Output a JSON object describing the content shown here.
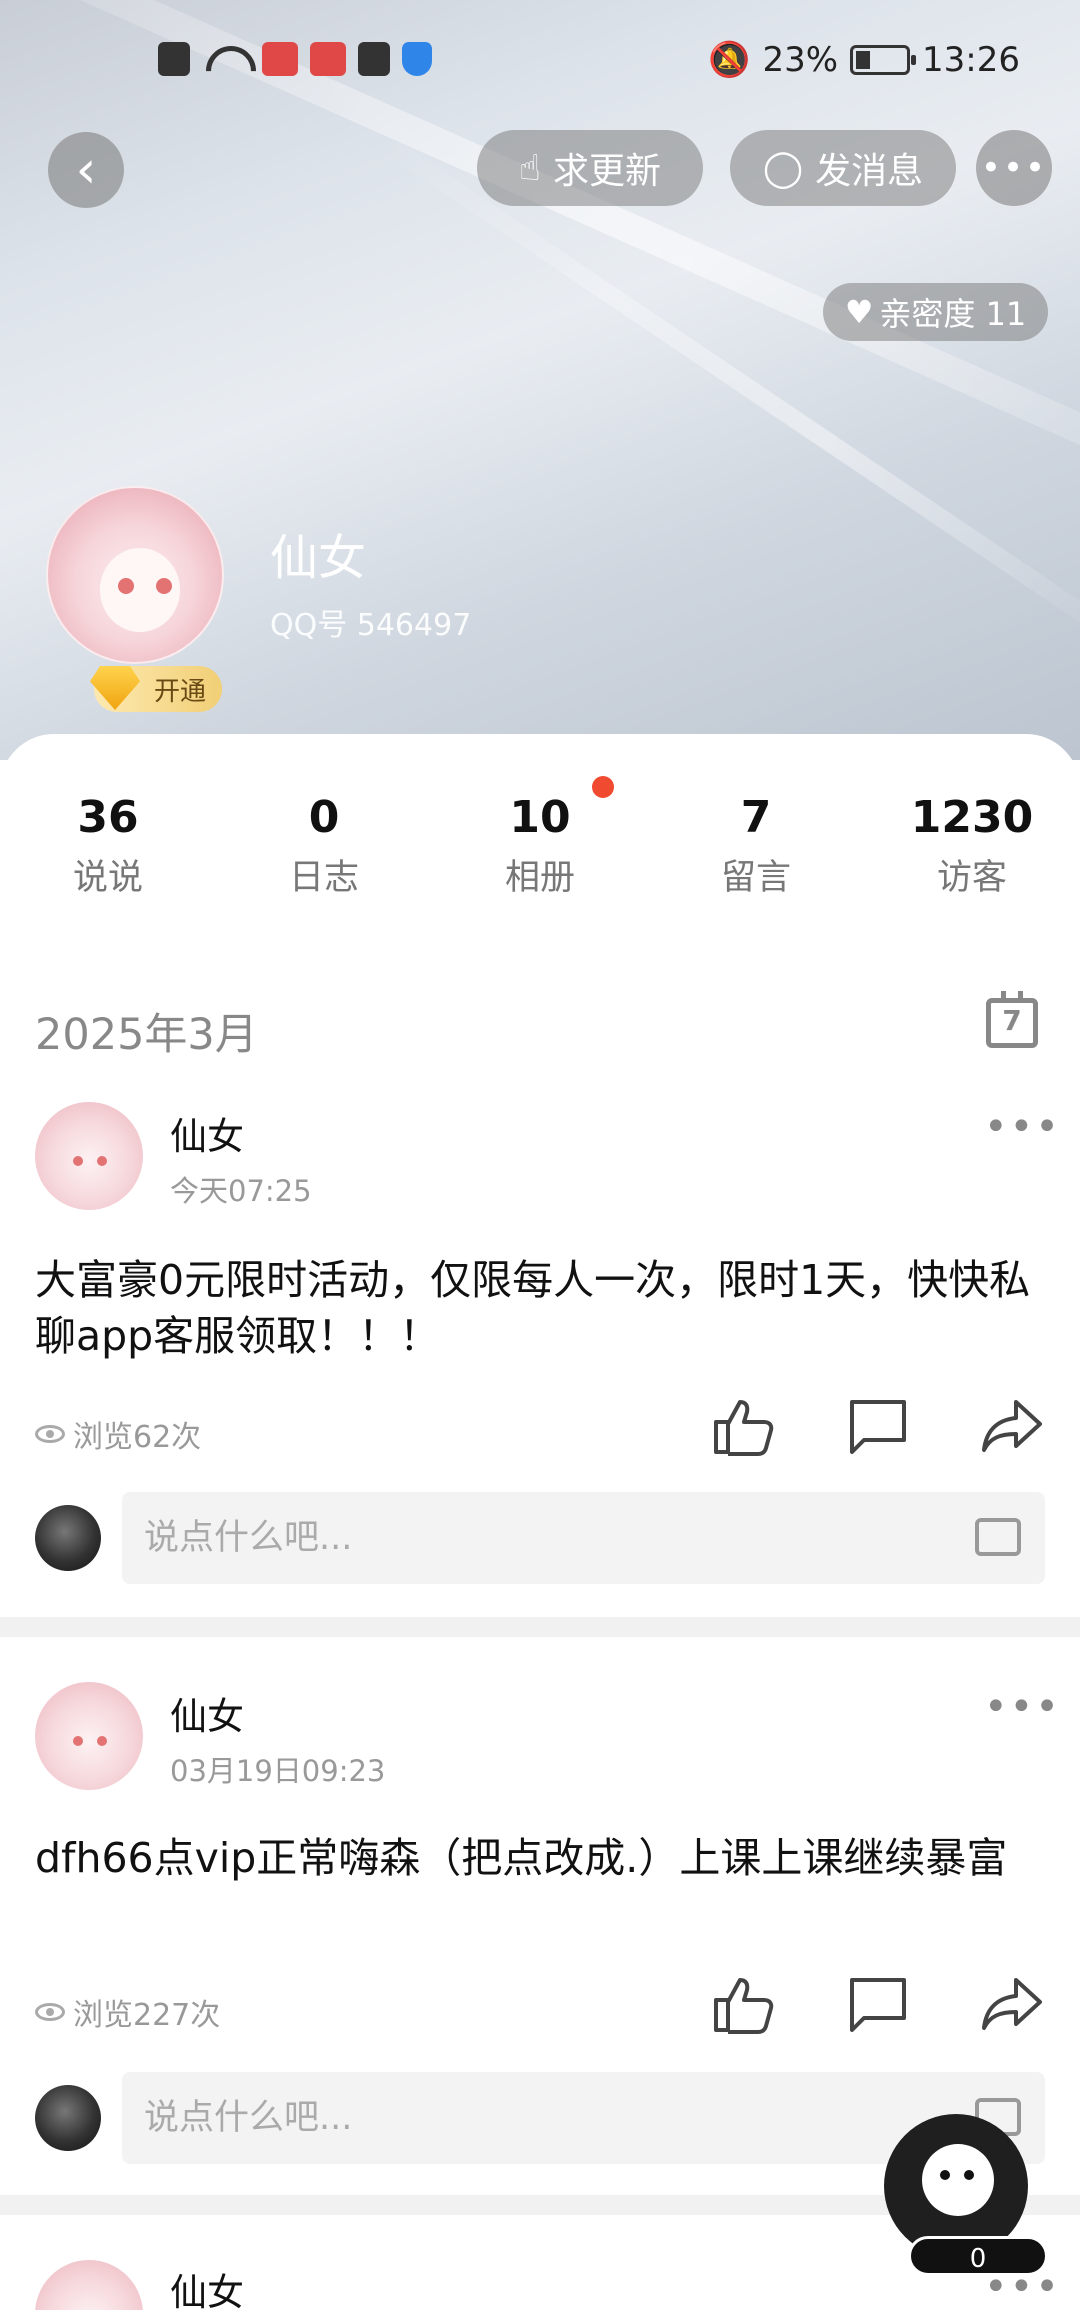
{
  "status_bar": {
    "battery": "23%",
    "time": "13:26"
  },
  "top_nav": {
    "request_update_label": "求更新",
    "send_message_label": "发消息"
  },
  "profile": {
    "intimacy_label": "亲密度 11",
    "name": "仙女",
    "qq": "QQ号 546497",
    "vip_label": "开通"
  },
  "stats": [
    {
      "value": "36",
      "label": "说说"
    },
    {
      "value": "0",
      "label": "日志"
    },
    {
      "value": "10",
      "label": "相册"
    },
    {
      "value": "7",
      "label": "留言"
    },
    {
      "value": "1230",
      "label": "访客"
    }
  ],
  "feed": {
    "month": "2025年3月",
    "calendar_day": "7",
    "comment_placeholder": "说点什么吧...",
    "posts": [
      {
        "author": "仙女",
        "time": "今天07:25",
        "text": " 大富豪0元限时活动，仅限每人一次，限时1天，快快私聊app客服领取！！！",
        "views": "浏览62次"
      },
      {
        "author": "仙女",
        "time": "03月19日09:23",
        "text": "dfh66点vip正常嗨森（把点改成.）上课上课继续暴富",
        "views": "浏览227次"
      },
      {
        "author": "仙女"
      }
    ]
  },
  "floating": {
    "count": "0"
  },
  "icons": [
    "back-icon",
    "hand-icon",
    "chat-bubble-icon",
    "more-icon",
    "heart-icon",
    "calendar-icon",
    "eye-icon",
    "thumbs-up-icon",
    "comment-icon",
    "share-icon"
  ]
}
